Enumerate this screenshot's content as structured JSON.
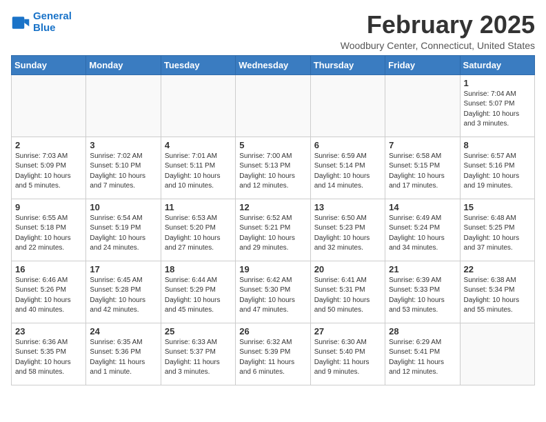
{
  "header": {
    "logo_line1": "General",
    "logo_line2": "Blue",
    "month_title": "February 2025",
    "location": "Woodbury Center, Connecticut, United States"
  },
  "weekdays": [
    "Sunday",
    "Monday",
    "Tuesday",
    "Wednesday",
    "Thursday",
    "Friday",
    "Saturday"
  ],
  "days": [
    {
      "num": "",
      "empty": true
    },
    {
      "num": "",
      "empty": true
    },
    {
      "num": "",
      "empty": true
    },
    {
      "num": "",
      "empty": true
    },
    {
      "num": "",
      "empty": true
    },
    {
      "num": "",
      "empty": true
    },
    {
      "num": "1",
      "info": "Sunrise: 7:04 AM\nSunset: 5:07 PM\nDaylight: 10 hours\nand 3 minutes."
    },
    {
      "num": "2",
      "info": "Sunrise: 7:03 AM\nSunset: 5:09 PM\nDaylight: 10 hours\nand 5 minutes."
    },
    {
      "num": "3",
      "info": "Sunrise: 7:02 AM\nSunset: 5:10 PM\nDaylight: 10 hours\nand 7 minutes."
    },
    {
      "num": "4",
      "info": "Sunrise: 7:01 AM\nSunset: 5:11 PM\nDaylight: 10 hours\nand 10 minutes."
    },
    {
      "num": "5",
      "info": "Sunrise: 7:00 AM\nSunset: 5:13 PM\nDaylight: 10 hours\nand 12 minutes."
    },
    {
      "num": "6",
      "info": "Sunrise: 6:59 AM\nSunset: 5:14 PM\nDaylight: 10 hours\nand 14 minutes."
    },
    {
      "num": "7",
      "info": "Sunrise: 6:58 AM\nSunset: 5:15 PM\nDaylight: 10 hours\nand 17 minutes."
    },
    {
      "num": "8",
      "info": "Sunrise: 6:57 AM\nSunset: 5:16 PM\nDaylight: 10 hours\nand 19 minutes."
    },
    {
      "num": "9",
      "info": "Sunrise: 6:55 AM\nSunset: 5:18 PM\nDaylight: 10 hours\nand 22 minutes."
    },
    {
      "num": "10",
      "info": "Sunrise: 6:54 AM\nSunset: 5:19 PM\nDaylight: 10 hours\nand 24 minutes."
    },
    {
      "num": "11",
      "info": "Sunrise: 6:53 AM\nSunset: 5:20 PM\nDaylight: 10 hours\nand 27 minutes."
    },
    {
      "num": "12",
      "info": "Sunrise: 6:52 AM\nSunset: 5:21 PM\nDaylight: 10 hours\nand 29 minutes."
    },
    {
      "num": "13",
      "info": "Sunrise: 6:50 AM\nSunset: 5:23 PM\nDaylight: 10 hours\nand 32 minutes."
    },
    {
      "num": "14",
      "info": "Sunrise: 6:49 AM\nSunset: 5:24 PM\nDaylight: 10 hours\nand 34 minutes."
    },
    {
      "num": "15",
      "info": "Sunrise: 6:48 AM\nSunset: 5:25 PM\nDaylight: 10 hours\nand 37 minutes."
    },
    {
      "num": "16",
      "info": "Sunrise: 6:46 AM\nSunset: 5:26 PM\nDaylight: 10 hours\nand 40 minutes."
    },
    {
      "num": "17",
      "info": "Sunrise: 6:45 AM\nSunset: 5:28 PM\nDaylight: 10 hours\nand 42 minutes."
    },
    {
      "num": "18",
      "info": "Sunrise: 6:44 AM\nSunset: 5:29 PM\nDaylight: 10 hours\nand 45 minutes."
    },
    {
      "num": "19",
      "info": "Sunrise: 6:42 AM\nSunset: 5:30 PM\nDaylight: 10 hours\nand 47 minutes."
    },
    {
      "num": "20",
      "info": "Sunrise: 6:41 AM\nSunset: 5:31 PM\nDaylight: 10 hours\nand 50 minutes."
    },
    {
      "num": "21",
      "info": "Sunrise: 6:39 AM\nSunset: 5:33 PM\nDaylight: 10 hours\nand 53 minutes."
    },
    {
      "num": "22",
      "info": "Sunrise: 6:38 AM\nSunset: 5:34 PM\nDaylight: 10 hours\nand 55 minutes."
    },
    {
      "num": "23",
      "info": "Sunrise: 6:36 AM\nSunset: 5:35 PM\nDaylight: 10 hours\nand 58 minutes."
    },
    {
      "num": "24",
      "info": "Sunrise: 6:35 AM\nSunset: 5:36 PM\nDaylight: 11 hours\nand 1 minute."
    },
    {
      "num": "25",
      "info": "Sunrise: 6:33 AM\nSunset: 5:37 PM\nDaylight: 11 hours\nand 3 minutes."
    },
    {
      "num": "26",
      "info": "Sunrise: 6:32 AM\nSunset: 5:39 PM\nDaylight: 11 hours\nand 6 minutes."
    },
    {
      "num": "27",
      "info": "Sunrise: 6:30 AM\nSunset: 5:40 PM\nDaylight: 11 hours\nand 9 minutes."
    },
    {
      "num": "28",
      "info": "Sunrise: 6:29 AM\nSunset: 5:41 PM\nDaylight: 11 hours\nand 12 minutes."
    },
    {
      "num": "",
      "empty": true
    }
  ]
}
